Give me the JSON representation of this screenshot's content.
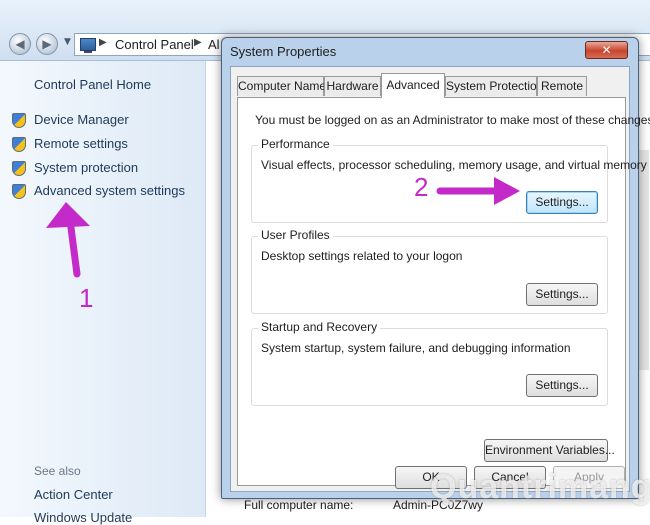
{
  "explorer": {
    "address_segments": [
      "Control Panel",
      "Al"
    ],
    "left_pane": {
      "home_link": "Control Panel Home",
      "items": [
        {
          "label": "Device Manager"
        },
        {
          "label": "Remote settings"
        },
        {
          "label": "System protection"
        },
        {
          "label": "Advanced system settings"
        }
      ],
      "see_also_heading": "See also",
      "see_also_items": [
        "Action Center",
        "Windows Update"
      ]
    },
    "background_text": {
      "full_computer_name_label": "Full computer name:",
      "full_computer_name_value": "Admin-PC0Z7wy"
    }
  },
  "dialog": {
    "title": "System Properties",
    "close_label": "✕",
    "tabs": [
      "Computer Name",
      "Hardware",
      "Advanced",
      "System Protection",
      "Remote"
    ],
    "active_tab": "Advanced",
    "admin_note": "You must be logged on as an Administrator to make most of these changes.",
    "groups": [
      {
        "title": "Performance",
        "description": "Visual effects, processor scheduling, memory usage, and virtual memory",
        "button": "Settings..."
      },
      {
        "title": "User Profiles",
        "description": "Desktop settings related to your logon",
        "button": "Settings..."
      },
      {
        "title": "Startup and Recovery",
        "description": "System startup, system failure, and debugging information",
        "button": "Settings..."
      }
    ],
    "env_button": "Environment Variables...",
    "ok_button": "OK",
    "cancel_button": "Cancel",
    "apply_button": "Apply"
  },
  "annotations": {
    "step1": "1",
    "step2": "2",
    "color": "#c42ac9"
  },
  "watermark": "Quantrimang"
}
